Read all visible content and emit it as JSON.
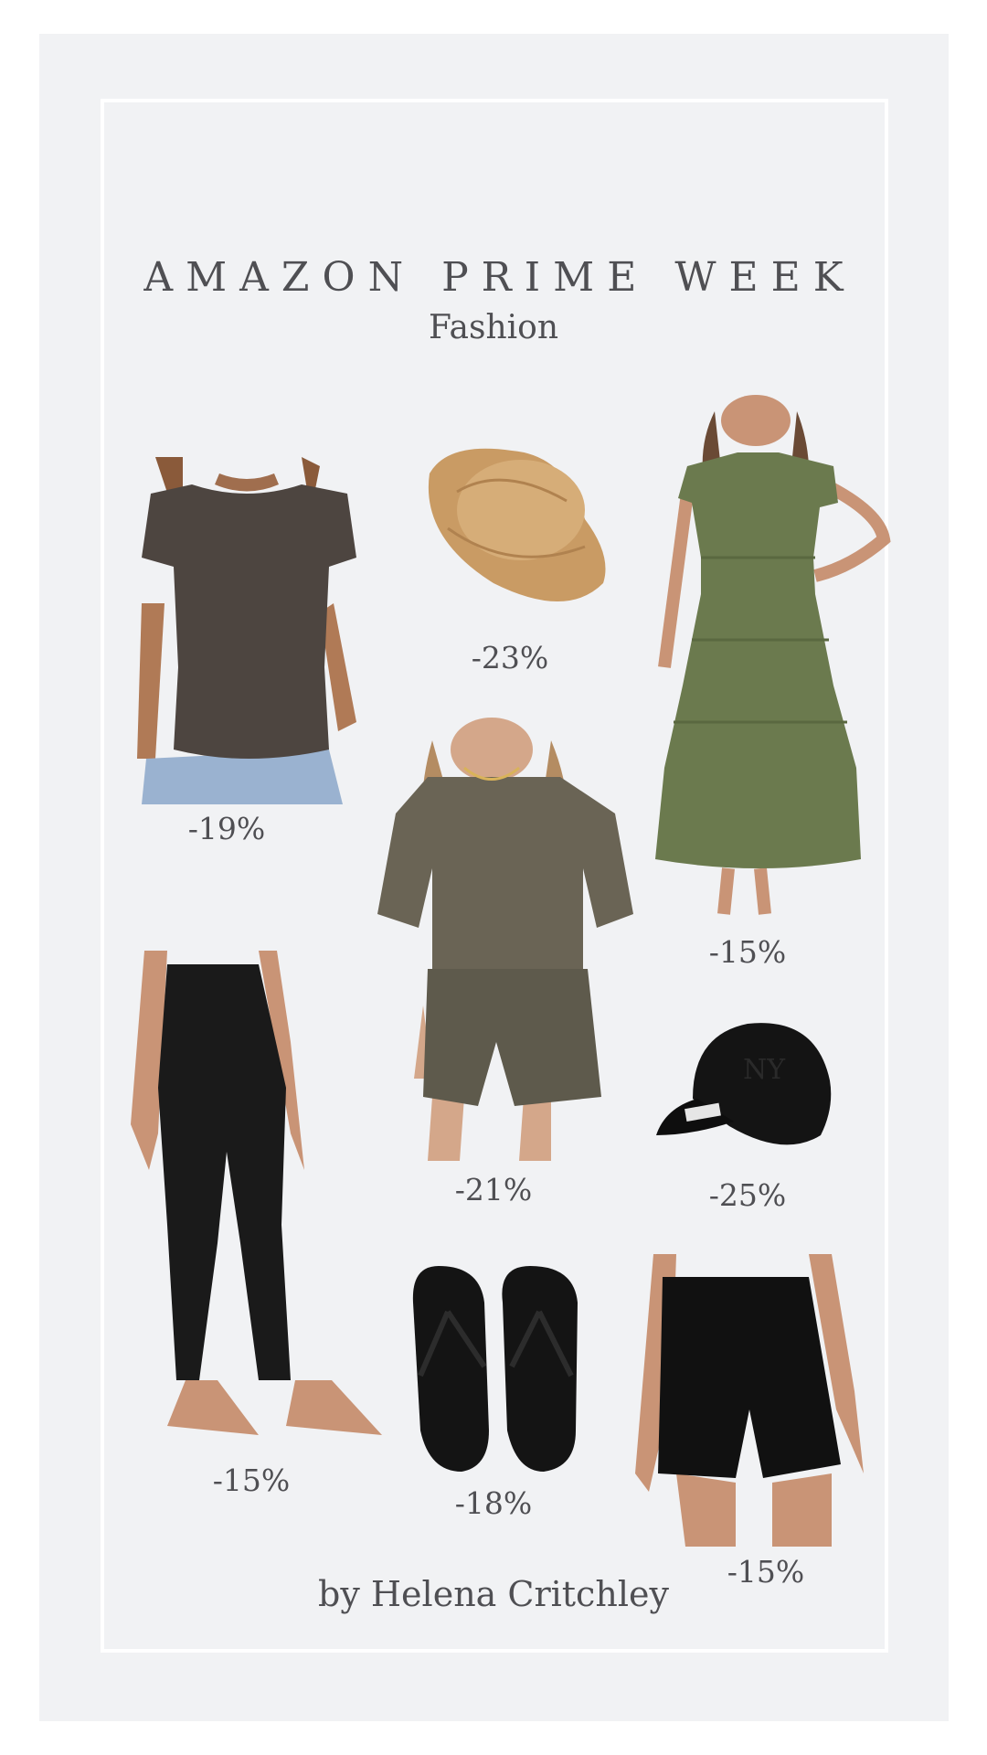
{
  "header": {
    "title": "AMAZON PRIME WEEK",
    "subtitle": "Fashion"
  },
  "footer": {
    "credit": "by Helena Critchley"
  },
  "colors": {
    "background": "#f1f2f4",
    "frame": "#ffffff",
    "text": "#4f4f53"
  },
  "products": [
    {
      "name": "fitted-tee",
      "discount": "-19%"
    },
    {
      "name": "straw-bucket-hat",
      "discount": "-23%"
    },
    {
      "name": "tiered-midi-dress",
      "discount": "-15%"
    },
    {
      "name": "lounge-set",
      "discount": "-21%"
    },
    {
      "name": "baseball-cap",
      "discount": "-25%"
    },
    {
      "name": "leggings",
      "discount": "-15%"
    },
    {
      "name": "flip-flops",
      "discount": "-18%"
    },
    {
      "name": "biker-shorts",
      "discount": "-15%"
    }
  ]
}
